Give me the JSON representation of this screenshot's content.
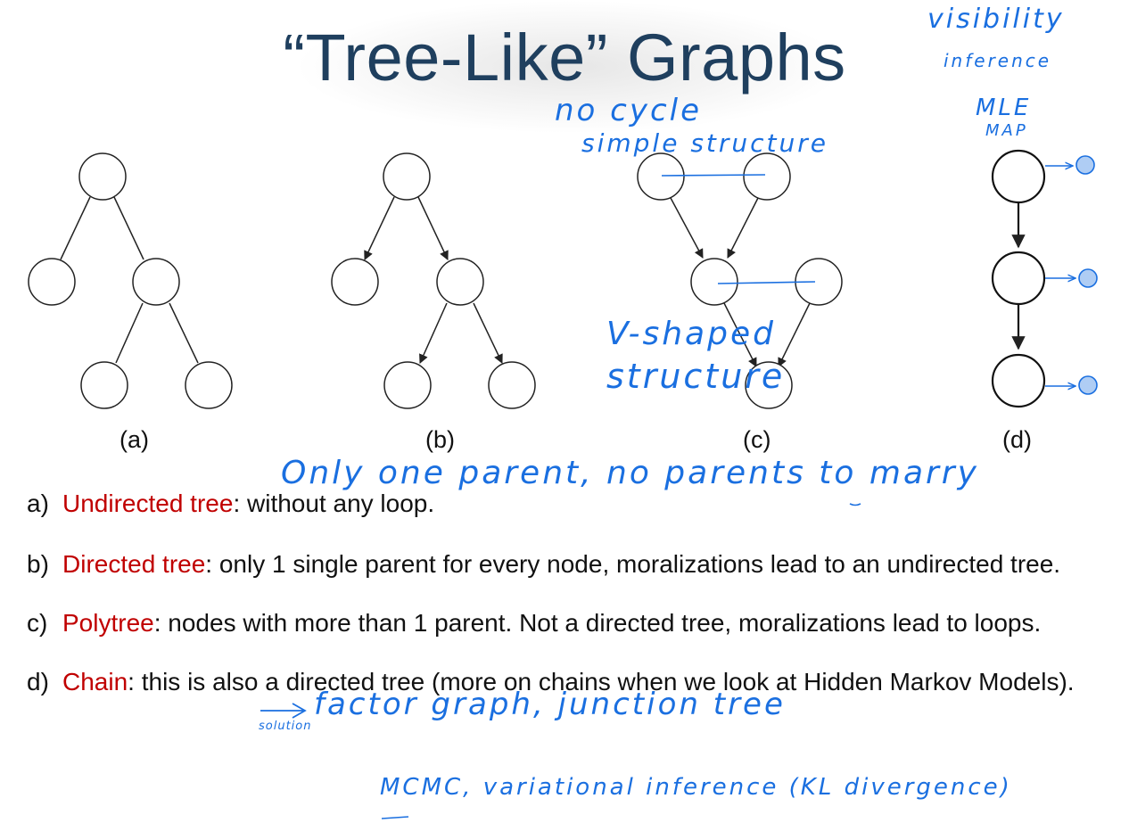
{
  "title": "“Tree-Like” Graphs",
  "captions": [
    "(a)",
    "(b)",
    "(c)",
    "(d)"
  ],
  "bullets": [
    {
      "marker": "a)",
      "term": "Undirected tree",
      "text": ": without any loop."
    },
    {
      "marker": "b)",
      "term": "Directed tree",
      "text": ": only 1 single parent for every node, moralizations lead to an undirected tree."
    },
    {
      "marker": "c)",
      "term": "Polytree",
      "text": ": nodes with more than 1 parent. Not a directed tree, moralizations lead to loops."
    },
    {
      "marker": "d)",
      "term": "Chain",
      "text": ": this is also a directed tree (more on chains when we look at Hidden Markov Models)."
    }
  ],
  "annotations": {
    "visibility": "visibility",
    "inference": "inference",
    "mle": "MLE",
    "map": "MAP",
    "no_cycle": "no cycle",
    "simple_structure": "simple structure",
    "v_shaped": "V-shaped",
    "structure": "structure",
    "only_one_parent": "Only one parent, no parents to marry",
    "factor_graph": "factor graph, junction tree",
    "solution": "solution",
    "mcmc": "MCMC, variational inference (KL divergence)"
  },
  "colors": {
    "title": "#1f3f5e",
    "term": "#c00000",
    "ink": "#1a6fe0",
    "node_stroke": "#222222"
  }
}
